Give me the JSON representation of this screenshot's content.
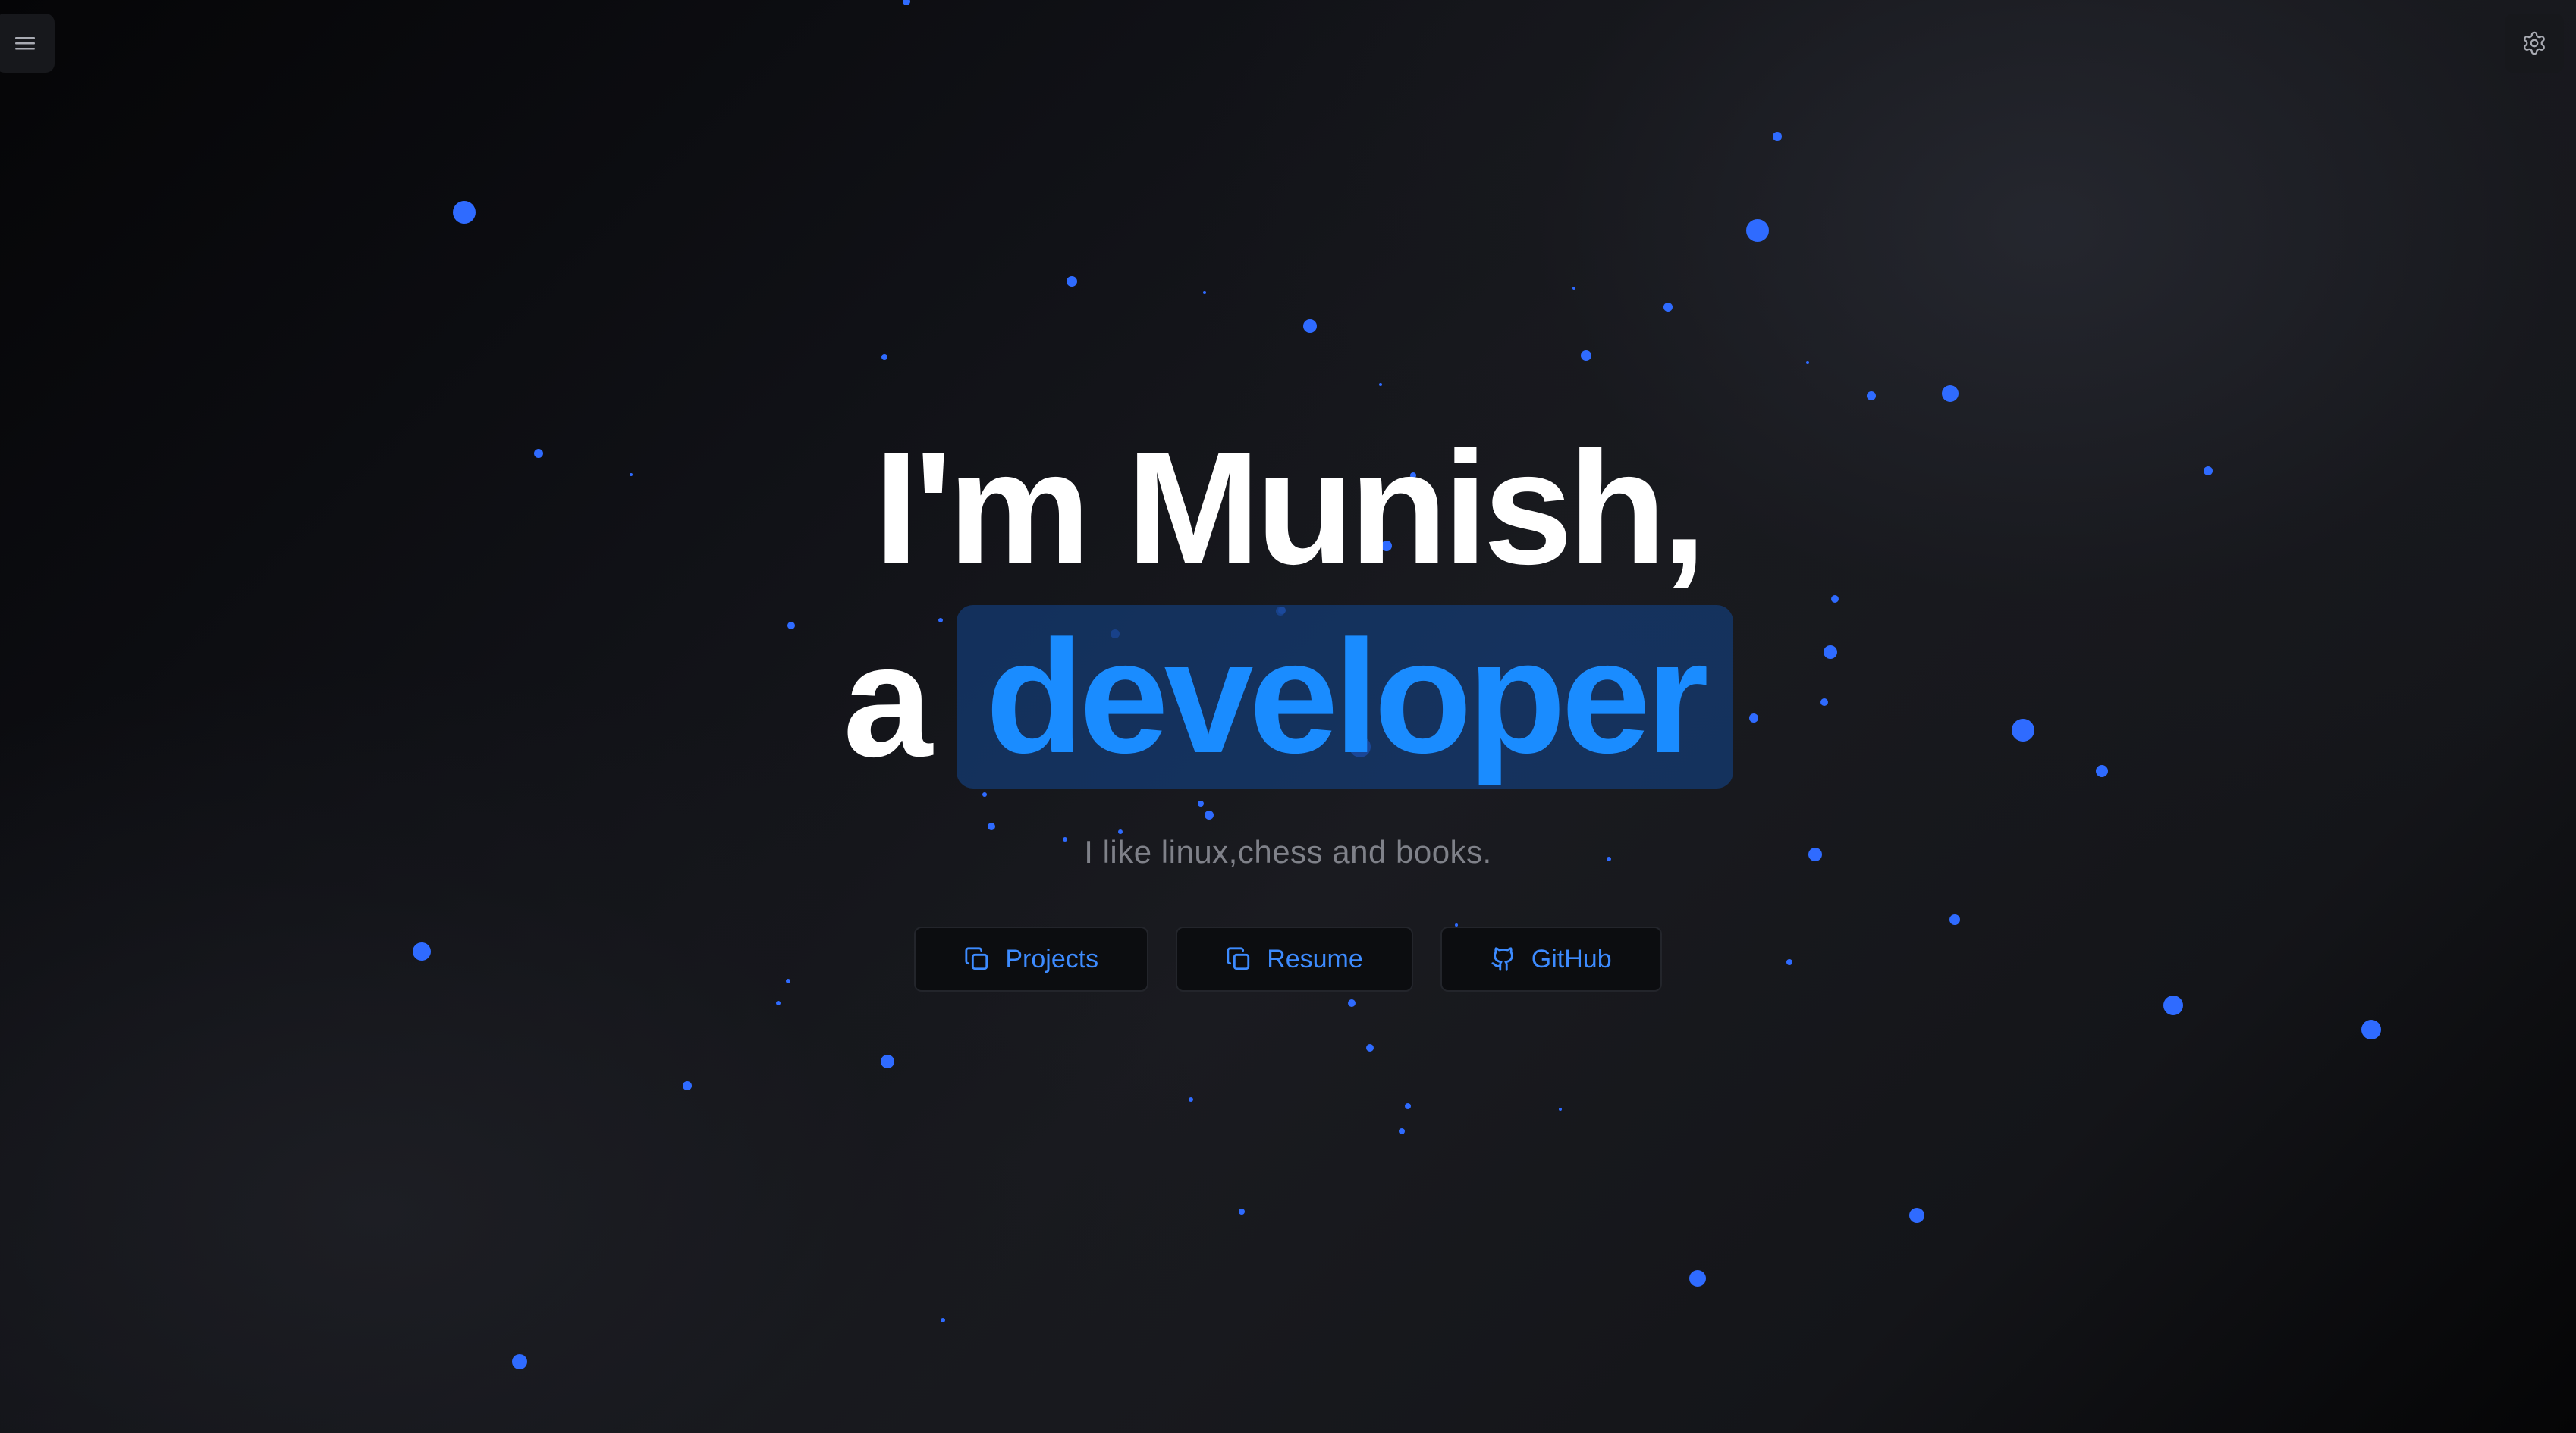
{
  "header": {
    "menu_icon": "hamburger-menu-icon",
    "settings_icon": "gear-icon"
  },
  "hero": {
    "line1": "I'm Munish,",
    "line2_prefix": "a",
    "line2_highlight": "developer",
    "tagline": "I like linux,chess and books."
  },
  "buttons": [
    {
      "label": "Projects",
      "icon": "copy-icon"
    },
    {
      "label": "Resume",
      "icon": "copy-icon"
    },
    {
      "label": "GitHub",
      "icon": "github-icon"
    }
  ],
  "colors": {
    "accent": "#1a8cff",
    "button_text": "#3d8bff",
    "particle": "#2f6bff",
    "highlight_bg": "#133c76",
    "tagline": "#7f8189",
    "background": "#0d0e12"
  }
}
